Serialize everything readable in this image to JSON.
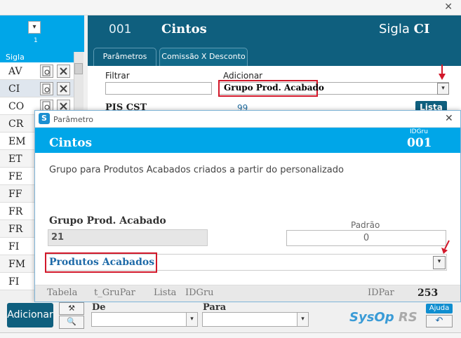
{
  "left": {
    "dropdown_num": "1",
    "sigla_header": "Sigla",
    "rows": [
      "AV",
      "CI",
      "CO",
      "CR",
      "EM",
      "ET",
      "FE",
      "FF",
      "FR",
      "FR",
      "FI",
      "FM",
      "FI"
    ]
  },
  "header": {
    "code": "001",
    "title": "Cintos",
    "sigla_label": "Sigla",
    "sigla_value": "CI"
  },
  "tabs": [
    {
      "label": "Parâmetros"
    },
    {
      "label": "Comissão X Desconto"
    }
  ],
  "filter": {
    "filtrar_label": "Filtrar",
    "adicionar_label": "Adicionar",
    "adicionar_value": "Grupo Prod. Acabado"
  },
  "pis": {
    "label": "PIS CST",
    "value": "99",
    "lista_label": "Lista"
  },
  "dialog": {
    "window_title": "Parâmetro",
    "title": "Cintos",
    "id_label": "IDGru",
    "id_value": "001",
    "description": "Grupo para Produtos Acabados criados a partir do personalizado",
    "param_label": "Grupo Prod. Acabado",
    "param_value": "21",
    "padrao_label": "Padrão",
    "padrao_value": "0",
    "combo_value": "Produtos Acabados",
    "footer": {
      "tabela_label": "Tabela",
      "tabela_value": "t_GruPar",
      "lista_label": "Lista",
      "lista_value": "IDGru",
      "idpar_label": "IDPar",
      "idpar_value": "253"
    }
  },
  "bottom": {
    "add_label": "Adicionar",
    "de_label": "De",
    "para_label": "Para",
    "brand_a": "SysOp",
    "brand_b": "RS",
    "ajuda_label": "Ajuda"
  },
  "colors": {
    "accent": "#00a6e8",
    "dark": "#0f5f7e",
    "highlight": "#d2182a"
  }
}
